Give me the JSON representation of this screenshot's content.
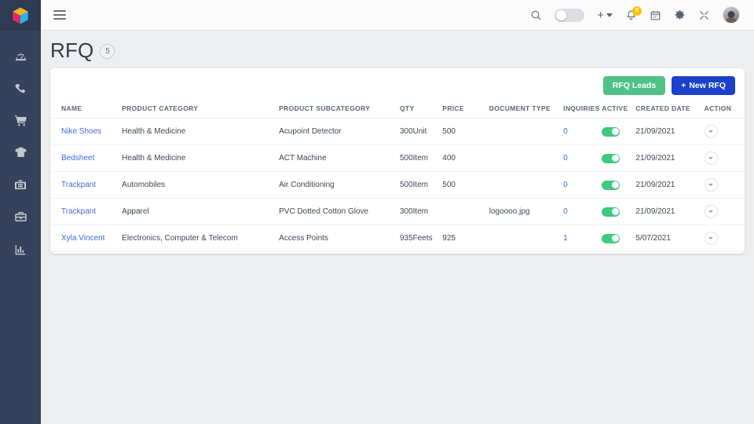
{
  "app": {
    "logo_name": "cube-logo",
    "sidebar": {
      "items": [
        {
          "icon": "dashboard-icon",
          "name": "sidebar-item-dashboard"
        },
        {
          "icon": "phone-icon",
          "name": "sidebar-item-calls"
        },
        {
          "icon": "cart-icon",
          "name": "sidebar-item-orders"
        },
        {
          "icon": "tshirt-icon",
          "name": "sidebar-item-products"
        },
        {
          "icon": "briefcase-icon",
          "name": "sidebar-item-inbox"
        },
        {
          "icon": "toolbox-icon",
          "name": "sidebar-item-tools"
        },
        {
          "icon": "bar-chart-icon",
          "name": "sidebar-item-reports"
        }
      ]
    },
    "topbar": {
      "menu_icon": "hamburger-icon",
      "search_icon": "search-icon",
      "theme_toggle": {
        "name": "theme-toggle",
        "state": "off"
      },
      "add_menu": {
        "label": "+",
        "caret": "chevron-down-icon"
      },
      "notifications": {
        "icon": "bell-icon",
        "badge": "0",
        "badge_color": "#ffc107"
      },
      "calendar_icon": "calendar-icon",
      "settings_icon": "gear-icon",
      "fullscreen_icon": "expand-icon",
      "avatar": "user-avatar"
    }
  },
  "page": {
    "title": "RFQ",
    "count": "5"
  },
  "toolbar": {
    "leads_label": "RFQ Leads",
    "new_label": "New RFQ",
    "new_prefix": "+",
    "leads_color": "#4fc387",
    "new_color": "#1b40c9"
  },
  "table": {
    "columns": [
      "NAME",
      "PRODUCT CATEGORY",
      "PRODUCT SUBCATEGORY",
      "QTY",
      "PRICE",
      "DOCUMENT TYPE",
      "INQUIRIES",
      "ACTIVE",
      "CREATED DATE",
      "ACTION"
    ],
    "rows": [
      {
        "name": "Nike Shoes",
        "category": "Health & Medicine",
        "subcategory": "Acupoint Detector",
        "qty": "300Unit",
        "price": "500",
        "document_type": "",
        "inquiries": "0",
        "active": "on",
        "created_date": "21/09/2021"
      },
      {
        "name": "Bedsheet",
        "category": "Health & Medicine",
        "subcategory": "ACT Machine",
        "qty": "500Item",
        "price": "400",
        "document_type": "",
        "inquiries": "0",
        "active": "on",
        "created_date": "21/09/2021"
      },
      {
        "name": "Trackpant",
        "category": "Automobiles",
        "subcategory": "Air Conditioning",
        "qty": "500Item",
        "price": "500",
        "document_type": "",
        "inquiries": "0",
        "active": "on",
        "created_date": "21/09/2021"
      },
      {
        "name": "Trackpant",
        "category": "Apparel",
        "subcategory": "PVC Dotted Cotton Glove",
        "qty": "300Item",
        "price": "",
        "document_type": "logoooo.jpg",
        "inquiries": "0",
        "active": "on",
        "created_date": "21/09/2021"
      },
      {
        "name": "Xyla Vincent",
        "category": "Electronics, Computer & Telecom",
        "subcategory": "Access Points",
        "qty": "935Feets",
        "price": "925",
        "document_type": "",
        "inquiries": "1",
        "active": "on",
        "created_date": "5/07/2021"
      }
    ]
  },
  "colors": {
    "sidebar": "#34425b",
    "link": "#3f6ad8",
    "toggle_on": "#3ec97f",
    "page_bg": "#edeef0"
  }
}
